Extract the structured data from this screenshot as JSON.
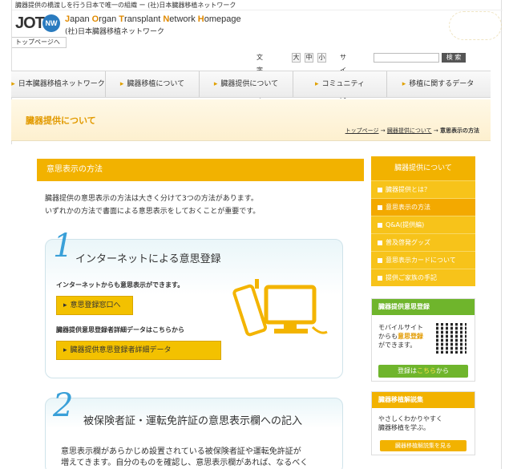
{
  "header": {
    "tagline": "臓器提供の橋渡しを行う日本で唯一の組織 ー (社)日本臓器移植ネットワーク",
    "logo_text": "JOT",
    "logo_badge": "NW",
    "brand_parts": [
      {
        "cap": "J",
        "rest": "apan "
      },
      {
        "cap": "O",
        "rest": "rgan "
      },
      {
        "cap": "T",
        "rest": "ransplant "
      },
      {
        "cap": "N",
        "rest": "etwork "
      },
      {
        "cap": "H",
        "rest": "omepage"
      }
    ],
    "org_name": "(社)日本臓器移植ネットワーク",
    "top_link": "トップページへ"
  },
  "tools": {
    "font_size_label": "文字サイズ",
    "font_sizes": [
      "大",
      "中",
      "小"
    ],
    "search_label": "サイト内検索",
    "search_value": "",
    "search_button": "検 索"
  },
  "global_nav": [
    "日本臓器移植ネットワークとは",
    "臓器移植について",
    "臓器提供について",
    "コミュニティ",
    "移植に関するデータ"
  ],
  "page": {
    "title": "臓器提供について",
    "breadcrumb": [
      "トップページ",
      "臓器提供について",
      "意思表示の方法"
    ],
    "breadcrumb_sep": "→"
  },
  "main": {
    "section_title": "意思表示の方法",
    "intro_lines": [
      "臓器提供の意思表示の方法は大きく分けて3つの方法があります。",
      "いずれかの方法で書面による意思表示をしておくことが重要です。"
    ],
    "method1": {
      "number": "1",
      "title": "インターネットによる意思登録",
      "sub1": "インターネットからも意思表示ができます。",
      "button1": "意思登録窓口へ",
      "sub2": "臓器提供意思登録者詳細データはこちらから",
      "button2": "臓器提供意思登録者詳細データ"
    },
    "method2": {
      "number": "2",
      "title": "被保険者証・運転免許証の意思表示欄への記入",
      "text_lines": [
        "意思表示欄があらかじめ設置されている被保険者証や運転免許証が",
        "増えてきます。自分のものを確認し、意思表示欄があれば、なるべく"
      ]
    }
  },
  "sidebar": {
    "heading": "臓器提供について",
    "items": [
      {
        "label": "臓器提供とは？",
        "active": false
      },
      {
        "label": "意思表示の方法",
        "active": true
      },
      {
        "label": "Q&A(提供編)",
        "active": false
      },
      {
        "label": "普及啓発グッズ",
        "active": false
      },
      {
        "label": "意思表示カードについて",
        "active": false
      },
      {
        "label": "提供ご家族の手記",
        "active": false
      }
    ],
    "mobile_box": {
      "heading": "臓器提供意思登録",
      "line1": "モバイルサイト",
      "line2a": "からも",
      "line2b": "意思登録",
      "line3": "ができます。",
      "button_a": "登録は",
      "button_b": "こちら",
      "button_c": "から"
    },
    "dict_box": {
      "heading": "臓器移植解説集",
      "line1": "やさしくわかりやすく",
      "line2": "臓器移植を学ぶ。",
      "button": "臓器移植解説集を見る"
    }
  },
  "colors": {
    "accent": "#f2b200",
    "green": "#6fb52c",
    "number": "#3aa0d8"
  }
}
